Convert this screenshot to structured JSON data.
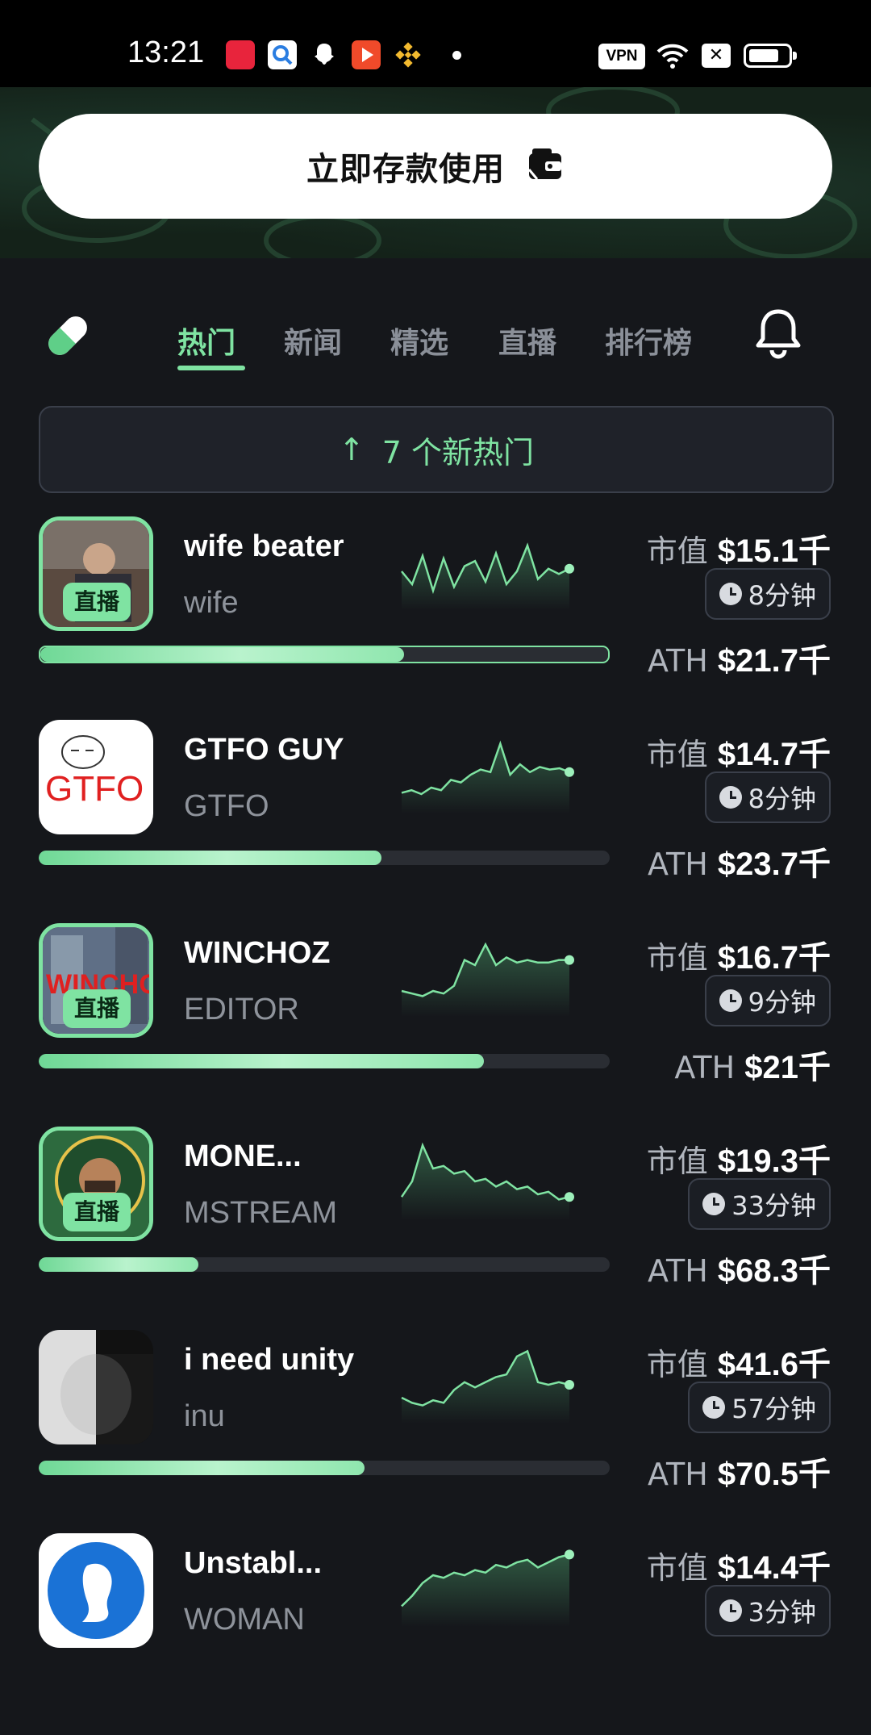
{
  "status_bar": {
    "time": "13:21",
    "vpn_label": "VPN",
    "app_icons": [
      "xiaohongshu-icon",
      "search-app-icon",
      "snapchat-icon",
      "video-app-icon",
      "binance-icon"
    ]
  },
  "banner": {
    "deposit_label": "立即存款使用"
  },
  "tabs": [
    {
      "label": "热门",
      "active": true
    },
    {
      "label": "新闻",
      "active": false
    },
    {
      "label": "精选",
      "active": false
    },
    {
      "label": "直播",
      "active": false
    },
    {
      "label": "排行榜",
      "active": false
    }
  ],
  "new_hot": {
    "arrow": "↑",
    "label": "7 个新热门"
  },
  "labels": {
    "market_cap": "市值",
    "ath": "ATH",
    "live": "直播"
  },
  "tokens": [
    {
      "name": "wife beater",
      "ticker": "wife",
      "market_cap": "$15.1千",
      "age": "8分钟",
      "ath": "$21.7千",
      "progress": 0.64,
      "live": true,
      "spark": [
        30,
        40,
        18,
        45,
        20,
        42,
        26,
        22,
        38,
        16,
        40,
        30,
        10,
        36,
        28,
        32,
        28
      ]
    },
    {
      "name": "GTFO GUY",
      "ticker": "GTFO",
      "market_cap": "$14.7千",
      "age": "8分钟",
      "ath": "$23.7千",
      "progress": 0.6,
      "live": false,
      "spark": [
        44,
        42,
        45,
        40,
        42,
        34,
        36,
        30,
        26,
        28,
        6,
        30,
        22,
        28,
        24,
        26,
        25,
        28
      ]
    },
    {
      "name": "WINCHOZ",
      "ticker": "EDITOR",
      "market_cap": "$16.7千",
      "age": "9分钟",
      "ath": "$21千",
      "progress": 0.78,
      "live": true,
      "spark": [
        40,
        42,
        44,
        40,
        42,
        36,
        16,
        20,
        4,
        20,
        14,
        18,
        16,
        18,
        18,
        16,
        16
      ]
    },
    {
      "name": "MONE...",
      "ticker": "MSTREAM",
      "market_cap": "$19.3千",
      "age": "33分钟",
      "ath": "$68.3千",
      "progress": 0.28,
      "live": true,
      "spark": [
        42,
        30,
        2,
        20,
        18,
        24,
        22,
        30,
        28,
        34,
        30,
        36,
        34,
        40,
        38,
        44,
        42
      ]
    },
    {
      "name": "i need unity",
      "ticker": "inu",
      "market_cap": "$41.6千",
      "age": "57分钟",
      "ath": "$70.5千",
      "progress": 0.57,
      "live": false,
      "spark": [
        40,
        44,
        46,
        42,
        44,
        34,
        28,
        32,
        28,
        24,
        22,
        8,
        4,
        28,
        30,
        28,
        30
      ]
    },
    {
      "name": "Unstabl...",
      "ticker": "WOMAN",
      "market_cap": "$14.4千",
      "age": "3分钟",
      "ath": "",
      "progress": 0,
      "live": false,
      "spark": [
        44,
        36,
        26,
        20,
        22,
        18,
        20,
        16,
        18,
        12,
        14,
        10,
        8,
        14,
        10,
        6,
        4
      ]
    }
  ]
}
